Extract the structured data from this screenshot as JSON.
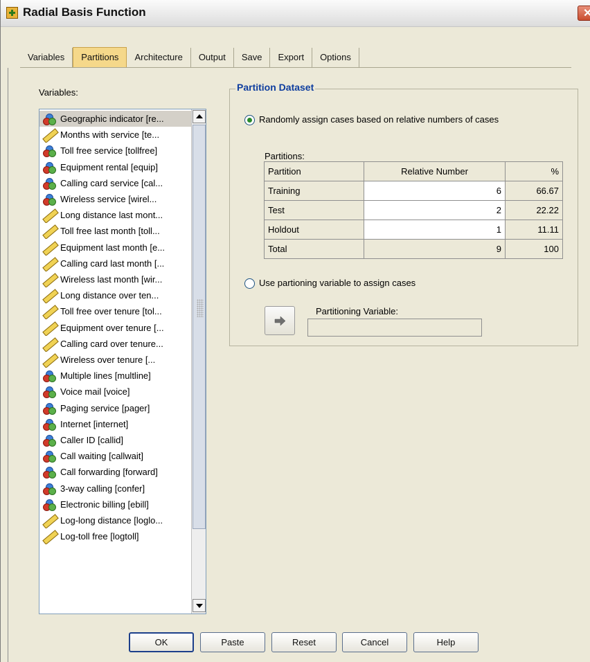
{
  "window": {
    "title": "Radial Basis Function"
  },
  "tabs": [
    {
      "label": "Variables",
      "active": false
    },
    {
      "label": "Partitions",
      "active": true
    },
    {
      "label": "Architecture",
      "active": false
    },
    {
      "label": "Output",
      "active": false
    },
    {
      "label": "Save",
      "active": false
    },
    {
      "label": "Export",
      "active": false
    },
    {
      "label": "Options",
      "active": false
    }
  ],
  "variables": {
    "label": "Variables:",
    "items": [
      {
        "label": "Geographic indicator [re...",
        "icon": "nominal-icon"
      },
      {
        "label": "Months with service [te...",
        "icon": "scale-icon"
      },
      {
        "label": "Toll free service [tollfree]",
        "icon": "nominal-icon"
      },
      {
        "label": "Equipment rental [equip]",
        "icon": "nominal-icon"
      },
      {
        "label": "Calling card service [cal...",
        "icon": "nominal-icon"
      },
      {
        "label": "Wireless service [wirel...",
        "icon": "nominal-icon"
      },
      {
        "label": "Long distance last mont...",
        "icon": "scale-icon"
      },
      {
        "label": "Toll free last month [toll...",
        "icon": "scale-icon"
      },
      {
        "label": "Equipment last month [e...",
        "icon": "scale-icon"
      },
      {
        "label": "Calling card last month [...",
        "icon": "scale-icon"
      },
      {
        "label": "Wireless last month [wir...",
        "icon": "scale-icon"
      },
      {
        "label": "Long distance over ten...",
        "icon": "scale-icon"
      },
      {
        "label": "Toll free over tenure [tol...",
        "icon": "scale-icon"
      },
      {
        "label": "Equipment over tenure [...",
        "icon": "scale-icon"
      },
      {
        "label": "Calling card over tenure...",
        "icon": "scale-icon"
      },
      {
        "label": "Wireless over tenure [...",
        "icon": "scale-icon"
      },
      {
        "label": "Multiple lines [multline]",
        "icon": "nominal-icon"
      },
      {
        "label": "Voice mail [voice]",
        "icon": "nominal-icon"
      },
      {
        "label": "Paging service [pager]",
        "icon": "nominal-icon"
      },
      {
        "label": "Internet [internet]",
        "icon": "nominal-icon"
      },
      {
        "label": "Caller ID [callid]",
        "icon": "nominal-icon"
      },
      {
        "label": "Call waiting [callwait]",
        "icon": "nominal-icon"
      },
      {
        "label": "Call forwarding [forward]",
        "icon": "nominal-icon"
      },
      {
        "label": "3-way calling [confer]",
        "icon": "nominal-icon"
      },
      {
        "label": "Electronic billing [ebill]",
        "icon": "nominal-icon"
      },
      {
        "label": "Log-long distance [loglo...",
        "icon": "scale-icon"
      },
      {
        "label": "Log-toll free [logtoll]",
        "icon": "scale-icon"
      }
    ]
  },
  "partition_dataset": {
    "title": "Partition Dataset",
    "option_random": "Randomly assign cases based on relative numbers of cases",
    "partitions_label": "Partitions:",
    "columns": [
      "Partition",
      "Relative Number",
      "%"
    ],
    "rows": [
      {
        "partition": "Training",
        "relative": "6",
        "percent": "66.67"
      },
      {
        "partition": "Test",
        "relative": "2",
        "percent": "22.22"
      },
      {
        "partition": "Holdout",
        "relative": "1",
        "percent": "11.11"
      },
      {
        "partition": "Total",
        "relative": "9",
        "percent": "100"
      }
    ],
    "option_variable": "Use partioning variable to assign cases",
    "partitioning_variable_label": "Partitioning Variable:",
    "partitioning_variable_value": "",
    "selected_option": "random"
  },
  "buttons": {
    "ok": "OK",
    "paste": "Paste",
    "reset": "Reset",
    "cancel": "Cancel",
    "help": "Help"
  },
  "colors": {
    "dialog_bg": "#ece9d8",
    "active_tab": "#f5d88a",
    "group_title": "#0f3e9f"
  }
}
